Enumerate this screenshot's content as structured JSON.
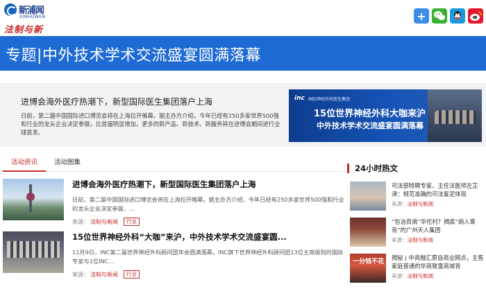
{
  "header": {
    "logo_text": "新浦闻",
    "logo_en": "XINHUWEN",
    "logo_sub": "法制与新闻",
    "share_icons": [
      "plus-icon",
      "wechat-icon",
      "qq-icon",
      "weibo-icon"
    ],
    "share_plus": "+"
  },
  "banner": {
    "title": "专题|中外技术学术交流盛宴圆满落幕",
    "color": "#1e6bd6"
  },
  "feature": {
    "title": "进博会海外医疗热潮下，新型国际医生集团落户上海",
    "desc": "日前，第二届中国国际进口博览会将在上海拉开帷幕。据主办方介绍，今年已经有250多家世界500强和行业的龙头企业决定参展，比首届明显增加，更多的新产品、新技术、新服务将在进博会期间进行全球首发。",
    "image": {
      "brand": "inc",
      "brand_sub": "国际神经外科医生集团",
      "line1": "15位世界神经外科大咖来沪",
      "line2": "中外技术学术交流盛宴圆满落幕"
    }
  },
  "tabs": [
    {
      "label": "活动资讯",
      "active": true
    },
    {
      "label": "活动图集",
      "active": false
    }
  ],
  "articles": [
    {
      "title": "进博会海外医疗热潮下，新型国际医生集团落户上海",
      "desc": "日前，第二届中国国际进口博览会将在上海拉开帷幕。据主办方介绍，今年已经有250多家世界500强和行业的龙头企业决定参展，...",
      "source_label": "来源：",
      "source": "法制与新闻",
      "tag": "行业"
    },
    {
      "title": "15位世界神经外科“大咖”来沪，中外技术学术交流盛宴圆...",
      "desc": "11月9日，INC第二届世界神经外科顾问团年会圆满落幕。INC旗下世界神经外科顾问团13位主席级别的国际专家与1位INC...",
      "source_label": "来源：",
      "source": "法制与新闻",
      "tag": "行业"
    }
  ],
  "sidebar": {
    "title": "24小时热文",
    "items": [
      {
        "text": "司法部特聘专家、主任法医师左芷津：规范准确的司法鉴定体现",
        "source_label": "来源：",
        "source": "法制与新闻"
      },
      {
        "text": "“包治百病”华佗村？揭底“病入膏肓”的广州天人集团",
        "source_label": "来源：",
        "source": "法制与新闻"
      },
      {
        "thumb_text": "一分钱不花",
        "text": "揭秘 | 中商融汇原自商业网点，主售家庭普通的华商致富商城背",
        "source_label": "来源：",
        "source": "法制与新闻"
      }
    ]
  },
  "colors": {
    "accent_red": "#c62828",
    "banner_blue": "#1e6bd6"
  }
}
